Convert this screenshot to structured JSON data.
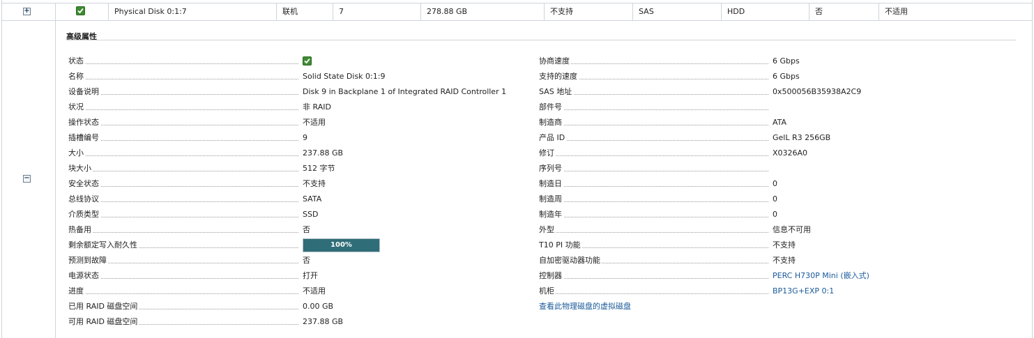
{
  "top_row": {
    "expander": "+",
    "name": "Physical Disk 0:1:7",
    "state": "联机",
    "slot": "7",
    "size": "278.88 GB",
    "security": "不支持",
    "bus": "SAS",
    "media": "HDD",
    "hotspare": "否",
    "remaining": "不适用"
  },
  "detail": {
    "collapse": "−",
    "title": "高级属性",
    "left": [
      {
        "label": "状态",
        "value": ""
      },
      {
        "label": "名称",
        "value": "Solid State Disk 0:1:9"
      },
      {
        "label": "设备说明",
        "value": "Disk 9 in Backplane 1 of Integrated RAID Controller 1"
      },
      {
        "label": "状况",
        "value": "非 RAID"
      },
      {
        "label": "操作状态",
        "value": "不适用"
      },
      {
        "label": "插槽编号",
        "value": "9"
      },
      {
        "label": "大小",
        "value": "237.88 GB"
      },
      {
        "label": "块大小",
        "value": "512 字节"
      },
      {
        "label": "安全状态",
        "value": "不支持"
      },
      {
        "label": "总线协议",
        "value": "SATA"
      },
      {
        "label": "介质类型",
        "value": "SSD"
      },
      {
        "label": "热备用",
        "value": "否"
      },
      {
        "label": "剩余额定写入耐久性",
        "value": "100%"
      },
      {
        "label": "预测到故障",
        "value": "否"
      },
      {
        "label": "电源状态",
        "value": "打开"
      },
      {
        "label": "进度",
        "value": "不适用"
      },
      {
        "label": "已用 RAID 磁盘空间",
        "value": "0.00 GB"
      },
      {
        "label": "可用 RAID 磁盘空间",
        "value": "237.88 GB"
      }
    ],
    "endurance_fraction": 1.0,
    "right": [
      {
        "label": "协商速度",
        "value": "6 Gbps"
      },
      {
        "label": "支持的速度",
        "value": "6 Gbps"
      },
      {
        "label": "SAS 地址",
        "value": "0x500056B35938A2C9"
      },
      {
        "label": "部件号",
        "value": ""
      },
      {
        "label": "制造商",
        "value": "ATA"
      },
      {
        "label": "产品 ID",
        "value": "GelL R3 256GB"
      },
      {
        "label": "修订",
        "value": "X0326A0"
      },
      {
        "label": "序列号",
        "value": ""
      },
      {
        "label": "制造日",
        "value": "0"
      },
      {
        "label": "制造周",
        "value": "0"
      },
      {
        "label": "制造年",
        "value": "0"
      },
      {
        "label": "外型",
        "value": "信息不可用"
      },
      {
        "label": "T10 PI 功能",
        "value": "不支持"
      },
      {
        "label": "自加密驱动器功能",
        "value": "不支持"
      },
      {
        "label": "控制器",
        "value": "PERC H730P Mini (嵌入式)"
      },
      {
        "label": "机柜",
        "value": "BP13G+EXP 0:1"
      }
    ],
    "view_vdisks_link": "查看此物理磁盘的虚拟磁盘"
  },
  "colors": {
    "status_ok": "#3f8b33",
    "progress_fill": "#2f6d78",
    "link": "#1a5a9a"
  }
}
